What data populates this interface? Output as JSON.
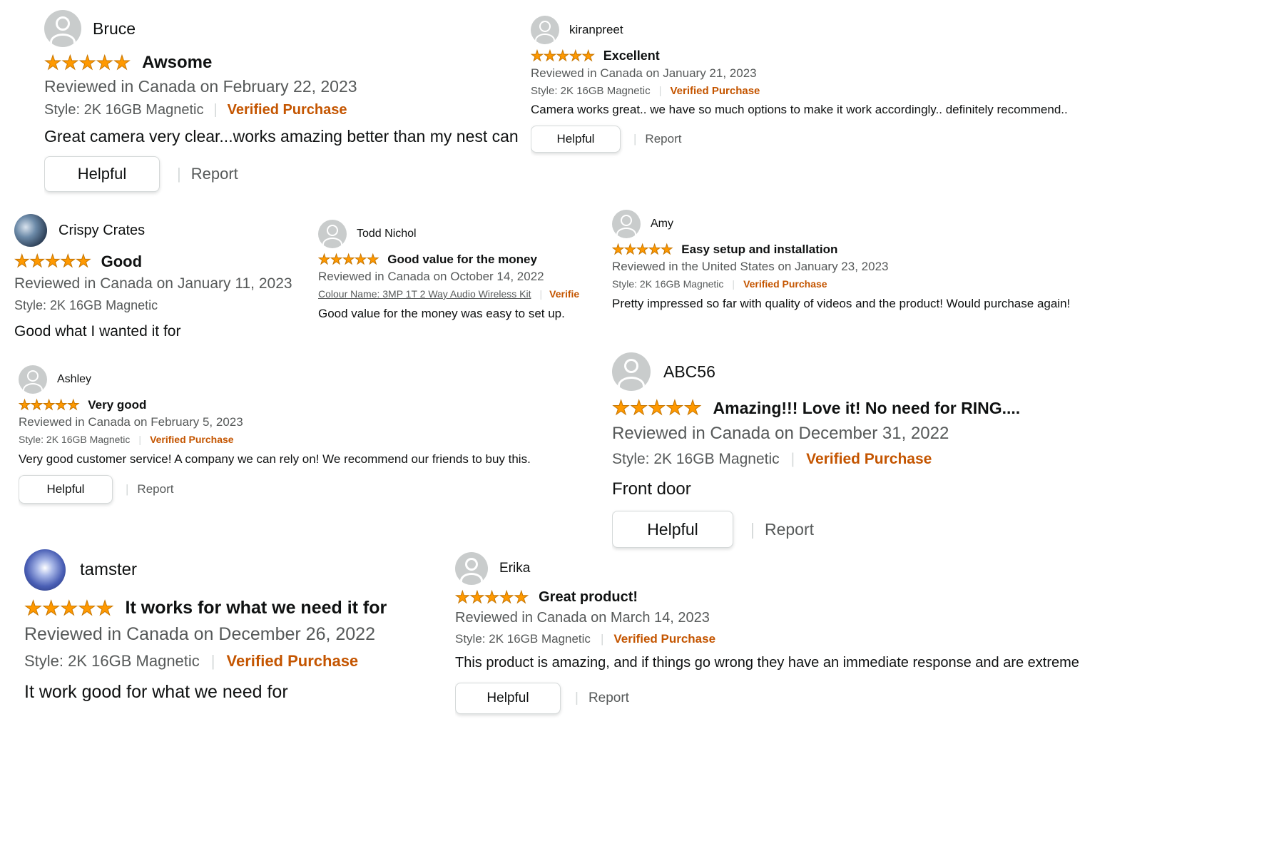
{
  "colors": {
    "star": "#ff9900",
    "verified": "#c45500",
    "meta": "#565959",
    "avatar_bg": "#c9cccc"
  },
  "reviews": [
    {
      "reviewer": "Bruce",
      "avatar": "person-icon",
      "rating": 5,
      "title": "Awsome",
      "meta": "Reviewed in Canada on February 22, 2023",
      "style": "Style: 2K 16GB Magnetic",
      "verified": "Verified Purchase",
      "body": "Great camera very clear...works amazing better than my nest can",
      "helpful": "Helpful",
      "report": "Report"
    },
    {
      "reviewer": "kiranpreet",
      "avatar": "person-icon",
      "rating": 5,
      "title": "Excellent",
      "meta": "Reviewed in Canada on January 21, 2023",
      "style": "Style: 2K 16GB Magnetic",
      "verified": "Verified Purchase",
      "body": "Camera works great.. we have so much options to make it work accordingly.. definitely recommend..",
      "helpful": "Helpful",
      "report": "Report"
    },
    {
      "reviewer": "Crispy Crates",
      "avatar": "profile-photo",
      "rating": 5,
      "title": "Good",
      "meta": "Reviewed in Canada on January 11, 2023",
      "style": "Style: 2K 16GB Magnetic",
      "body": "Good what I wanted it for"
    },
    {
      "reviewer": "Todd Nichol",
      "avatar": "person-icon",
      "rating": 5,
      "title": "Good value for the money",
      "meta": "Reviewed in Canada on October 14, 2022",
      "colour": "Colour Name: 3MP 1T 2 Way Audio Wireless Kit",
      "verified": "Verifie",
      "body": "Good value for the money was easy to set up."
    },
    {
      "reviewer": "Amy",
      "avatar": "person-icon",
      "rating": 5,
      "title": "Easy setup and installation",
      "meta": "Reviewed in the United States on January 23, 2023",
      "style": "Style: 2K 16GB Magnetic",
      "verified": "Verified Purchase",
      "body": "Pretty impressed so far with quality of videos and the product! Would purchase again!"
    },
    {
      "reviewer": "Ashley",
      "avatar": "person-icon",
      "rating": 5,
      "title": "Very good",
      "meta": "Reviewed in Canada on February 5, 2023",
      "style": "Style: 2K 16GB Magnetic",
      "verified": "Verified Purchase",
      "body": "Very good customer service! A company we can rely on! We recommend our friends to buy this.",
      "helpful": "Helpful",
      "report": "Report"
    },
    {
      "reviewer": "ABC56",
      "avatar": "person-icon",
      "rating": 5,
      "title": "Amazing!!! Love it! No need for RING....",
      "meta": "Reviewed in Canada on December 31, 2022",
      "style": "Style: 2K 16GB Magnetic",
      "verified": "Verified Purchase",
      "body": "Front door",
      "helpful": "Helpful",
      "report": "Report"
    },
    {
      "reviewer": "tamster",
      "avatar": "profile-photo",
      "rating": 5,
      "title": "It works for what we need it for",
      "meta": "Reviewed in Canada on December 26, 2022",
      "style": "Style: 2K 16GB Magnetic",
      "verified": "Verified Purchase",
      "body": "It work good for what we need for"
    },
    {
      "reviewer": "Erika",
      "avatar": "person-icon",
      "rating": 5,
      "title": "Great product!",
      "meta": "Reviewed in Canada on March 14, 2023",
      "style": "Style: 2K 16GB Magnetic",
      "verified": "Verified Purchase",
      "body": "This product is amazing, and if things go wrong they have an immediate response and are extreme",
      "helpful": "Helpful",
      "report": "Report"
    }
  ]
}
